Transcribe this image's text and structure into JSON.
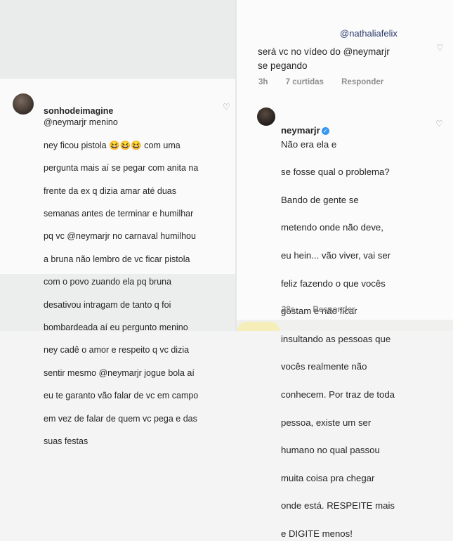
{
  "left_comment": {
    "username": "sonhodeimagine",
    "lines": [
      "@neymarjr menino",
      "ney ficou pistola 😆😆😆 com uma",
      "pergunta mais aí se pegar com anita na",
      "frente da ex q dizia amar até duas",
      "semanas antes de terminar e humilhar",
      "pq vc @neymarjr no carnaval humilhou",
      "a bruna não lembro de vc ficar pistola",
      "com o povo zuando ela pq bruna",
      "desativou intragam de tanto q foi",
      "bombardeada aí eu pergunto menino",
      "ney cadê o amor e respeito q vc dizia",
      "sentir mesmo @neymarjr jogue bola aí",
      "eu te garanto vão falar de vc em campo",
      "em vez de falar de quem vc pega e das",
      "suas festas"
    ]
  },
  "reply_comment": {
    "mention": "@nathaliafelix",
    "text_lines": [
      "será vc no vídeo do @neymarjr",
      "se pegando"
    ],
    "time": "3h",
    "likes": "7 curtidas",
    "reply_label": "Responder"
  },
  "neymar_comment": {
    "username": "neymarjr",
    "verified_glyph": "✓",
    "lines": [
      "Não era ela e",
      "se fosse qual o problema?",
      "Bando de gente se",
      "metendo onde não deve,",
      "eu hein... vão viver, vai ser",
      "feliz fazendo o que vocês",
      "gostam e não ficar",
      "insultando as pessoas que",
      "vocês realmente não",
      "conhecem. Por traz de toda",
      "pessoa, existe um ser",
      "humano no qual passou",
      "muita coisa pra chegar",
      "onde está. RESPEITE mais",
      "e DIGITE menos!"
    ],
    "time": "28s",
    "reply_label": "Responder"
  },
  "icons": {
    "like": "heart-icon",
    "verified": "verified-badge-icon"
  },
  "colors": {
    "mention": "#2a3a6a",
    "meta": "#8e8e8e",
    "verified": "#3897f0"
  }
}
